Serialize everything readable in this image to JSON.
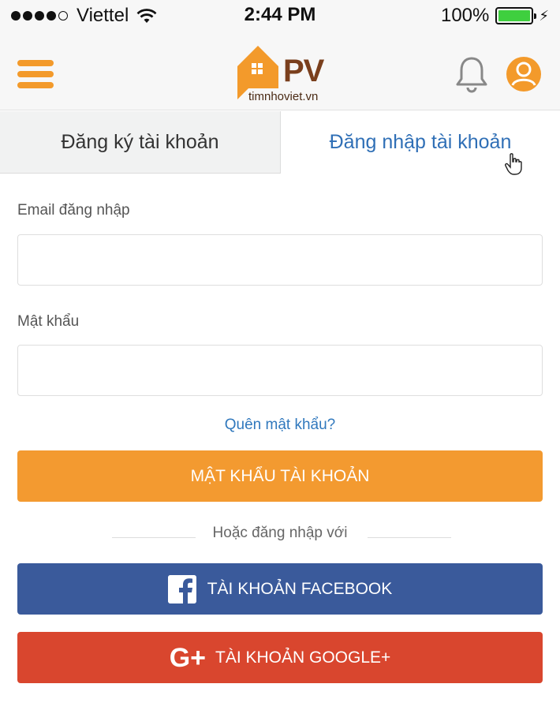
{
  "status_bar": {
    "carrier": "Viettel",
    "time": "2:44 PM",
    "battery": "100%",
    "signal_bars": 4
  },
  "header": {
    "logo_text": "PV",
    "logo_subtext": "timnhoviet.vn",
    "icons": [
      "menu-icon",
      "bell-icon",
      "user-icon"
    ],
    "accent_color": "#f39a2b"
  },
  "tabs": {
    "register_label": "Đăng ký tài khoản",
    "login_label": "Đăng nhập tài khoản",
    "active": "login"
  },
  "form": {
    "email_label": "Email đăng nhập",
    "email_value": "",
    "password_label": "Mật khẩu",
    "password_value": "",
    "forgot_label": "Quên mật khẩu?",
    "submit_label": "MẬT KHẨU TÀI KHOẢN",
    "or_label": "Hoặc đăng nhập với",
    "facebook_label": "TÀI KHOẢN FACEBOOK",
    "google_label": "TÀI KHOẢN GOOGLE+",
    "colors": {
      "primary": "#f39a30",
      "facebook": "#3a5a9b",
      "google": "#d9462e",
      "link": "#3078bd"
    }
  }
}
